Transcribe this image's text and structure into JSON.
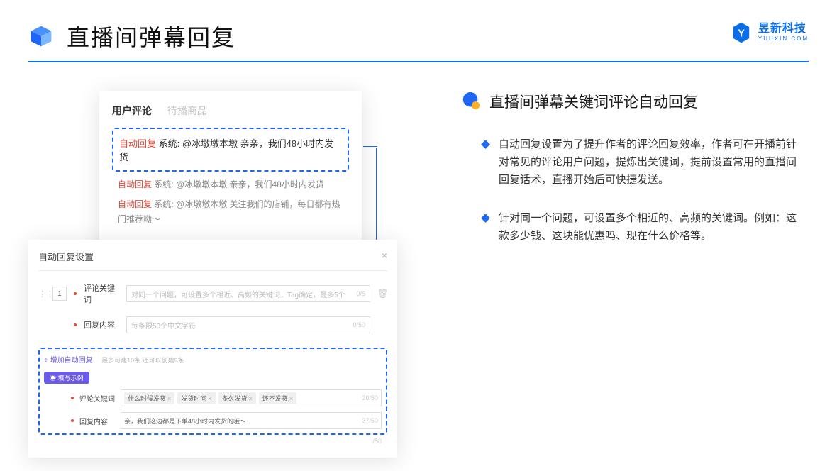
{
  "header": {
    "title": "直播间弹幕回复"
  },
  "brand": {
    "name": "昱新科技",
    "url": "YUUXIN.COM"
  },
  "comments": {
    "tab_active": "用户评论",
    "tab_inactive": "待播商品",
    "highlight": {
      "tag": "自动回复",
      "text": "系统: @冰墩墩本墩 亲亲，我们48小时内发货"
    },
    "rows": [
      {
        "tag": "自动回复",
        "text": "系统: @冰墩墩本墩 亲亲，我们48小时内发货"
      },
      {
        "tag": "自动回复",
        "text": "系统: @冰墩墩本墩 关注我们的店铺，每日都有热门推荐呦～"
      }
    ]
  },
  "settings": {
    "title": "自动回复设置",
    "num": "1",
    "kw_label": "评论关键词",
    "kw_placeholder": "对同一个问题，可设置多个相近、高频的关键词，Tag确定，最多5个",
    "kw_count": "0/5",
    "reply_label": "回复内容",
    "reply_placeholder": "每条限50个中文字符",
    "reply_count": "0/50",
    "add_link": "+ 增加自动回复",
    "add_hint": "最多可建10条 还可以创建9条",
    "badge": "◉ 填写示例",
    "ex_kw_label": "评论关键词",
    "ex_tags": [
      "什么时候发货",
      "发货时间",
      "多久发货",
      "还不发货"
    ],
    "ex_kw_count": "20/50",
    "ex_reply_label": "回复内容",
    "ex_reply_text": "亲，我们这边都是下单48小时内发货的哦～",
    "ex_reply_count": "37/50",
    "extra_count": "/50"
  },
  "right": {
    "heading": "直播间弹幕关键词评论自动回复",
    "bullet1": "自动回复设置为了提升作者的评论回复效率，作者可在开播前针对常见的评论用户问题，提炼出关键词，提前设置常用的直播间回复话术，直播开始后可快捷发送。",
    "bullet2": "针对同一个问题，可设置多个相近的、高频的关键词。例如：这款多少钱、这块能优惠吗、现在什么价格等。"
  }
}
